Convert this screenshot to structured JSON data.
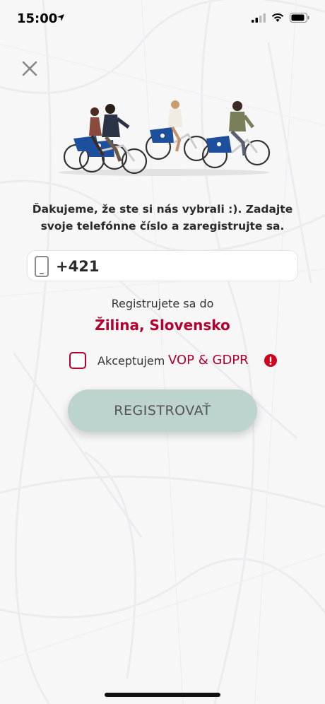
{
  "status_bar": {
    "time": "15:00"
  },
  "intro_text": "Ďakujeme, že ste si nás vybrali :). Zadajte svoje telefónne číslo a zaregistrujte sa.",
  "phone": {
    "value": "+421"
  },
  "registration": {
    "label": "Registrujete sa do",
    "city": "Žilina, Slovensko"
  },
  "terms": {
    "accept_label": "Akceptujem",
    "link_label": "VOP & GDPR",
    "checked": false
  },
  "register_button": {
    "label": "REGISTROVAŤ"
  },
  "colors": {
    "accent": "#b3002d",
    "button": "#bdd3cd",
    "bike_blue": "#1e4f9c"
  }
}
